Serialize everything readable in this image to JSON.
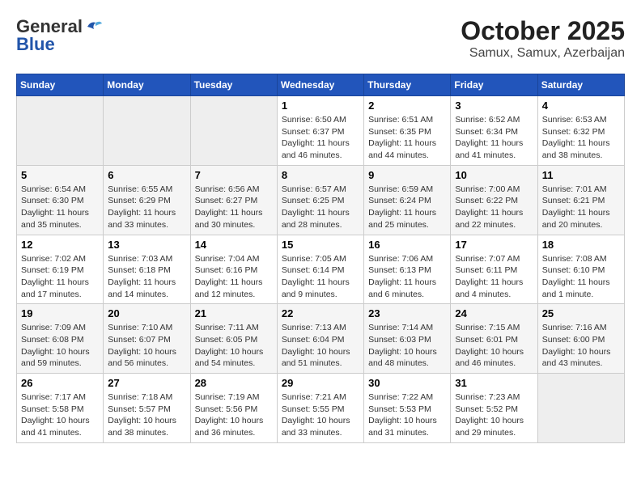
{
  "logo": {
    "line1": "General",
    "line2": "Blue"
  },
  "title": "October 2025",
  "subtitle": "Samux, Samux, Azerbaijan",
  "days_of_week": [
    "Sunday",
    "Monday",
    "Tuesday",
    "Wednesday",
    "Thursday",
    "Friday",
    "Saturday"
  ],
  "weeks": [
    [
      {
        "day": "",
        "info": ""
      },
      {
        "day": "",
        "info": ""
      },
      {
        "day": "",
        "info": ""
      },
      {
        "day": "1",
        "info": "Sunrise: 6:50 AM\nSunset: 6:37 PM\nDaylight: 11 hours and 46 minutes."
      },
      {
        "day": "2",
        "info": "Sunrise: 6:51 AM\nSunset: 6:35 PM\nDaylight: 11 hours and 44 minutes."
      },
      {
        "day": "3",
        "info": "Sunrise: 6:52 AM\nSunset: 6:34 PM\nDaylight: 11 hours and 41 minutes."
      },
      {
        "day": "4",
        "info": "Sunrise: 6:53 AM\nSunset: 6:32 PM\nDaylight: 11 hours and 38 minutes."
      }
    ],
    [
      {
        "day": "5",
        "info": "Sunrise: 6:54 AM\nSunset: 6:30 PM\nDaylight: 11 hours and 35 minutes."
      },
      {
        "day": "6",
        "info": "Sunrise: 6:55 AM\nSunset: 6:29 PM\nDaylight: 11 hours and 33 minutes."
      },
      {
        "day": "7",
        "info": "Sunrise: 6:56 AM\nSunset: 6:27 PM\nDaylight: 11 hours and 30 minutes."
      },
      {
        "day": "8",
        "info": "Sunrise: 6:57 AM\nSunset: 6:25 PM\nDaylight: 11 hours and 28 minutes."
      },
      {
        "day": "9",
        "info": "Sunrise: 6:59 AM\nSunset: 6:24 PM\nDaylight: 11 hours and 25 minutes."
      },
      {
        "day": "10",
        "info": "Sunrise: 7:00 AM\nSunset: 6:22 PM\nDaylight: 11 hours and 22 minutes."
      },
      {
        "day": "11",
        "info": "Sunrise: 7:01 AM\nSunset: 6:21 PM\nDaylight: 11 hours and 20 minutes."
      }
    ],
    [
      {
        "day": "12",
        "info": "Sunrise: 7:02 AM\nSunset: 6:19 PM\nDaylight: 11 hours and 17 minutes."
      },
      {
        "day": "13",
        "info": "Sunrise: 7:03 AM\nSunset: 6:18 PM\nDaylight: 11 hours and 14 minutes."
      },
      {
        "day": "14",
        "info": "Sunrise: 7:04 AM\nSunset: 6:16 PM\nDaylight: 11 hours and 12 minutes."
      },
      {
        "day": "15",
        "info": "Sunrise: 7:05 AM\nSunset: 6:14 PM\nDaylight: 11 hours and 9 minutes."
      },
      {
        "day": "16",
        "info": "Sunrise: 7:06 AM\nSunset: 6:13 PM\nDaylight: 11 hours and 6 minutes."
      },
      {
        "day": "17",
        "info": "Sunrise: 7:07 AM\nSunset: 6:11 PM\nDaylight: 11 hours and 4 minutes."
      },
      {
        "day": "18",
        "info": "Sunrise: 7:08 AM\nSunset: 6:10 PM\nDaylight: 11 hours and 1 minute."
      }
    ],
    [
      {
        "day": "19",
        "info": "Sunrise: 7:09 AM\nSunset: 6:08 PM\nDaylight: 10 hours and 59 minutes."
      },
      {
        "day": "20",
        "info": "Sunrise: 7:10 AM\nSunset: 6:07 PM\nDaylight: 10 hours and 56 minutes."
      },
      {
        "day": "21",
        "info": "Sunrise: 7:11 AM\nSunset: 6:05 PM\nDaylight: 10 hours and 54 minutes."
      },
      {
        "day": "22",
        "info": "Sunrise: 7:13 AM\nSunset: 6:04 PM\nDaylight: 10 hours and 51 minutes."
      },
      {
        "day": "23",
        "info": "Sunrise: 7:14 AM\nSunset: 6:03 PM\nDaylight: 10 hours and 48 minutes."
      },
      {
        "day": "24",
        "info": "Sunrise: 7:15 AM\nSunset: 6:01 PM\nDaylight: 10 hours and 46 minutes."
      },
      {
        "day": "25",
        "info": "Sunrise: 7:16 AM\nSunset: 6:00 PM\nDaylight: 10 hours and 43 minutes."
      }
    ],
    [
      {
        "day": "26",
        "info": "Sunrise: 7:17 AM\nSunset: 5:58 PM\nDaylight: 10 hours and 41 minutes."
      },
      {
        "day": "27",
        "info": "Sunrise: 7:18 AM\nSunset: 5:57 PM\nDaylight: 10 hours and 38 minutes."
      },
      {
        "day": "28",
        "info": "Sunrise: 7:19 AM\nSunset: 5:56 PM\nDaylight: 10 hours and 36 minutes."
      },
      {
        "day": "29",
        "info": "Sunrise: 7:21 AM\nSunset: 5:55 PM\nDaylight: 10 hours and 33 minutes."
      },
      {
        "day": "30",
        "info": "Sunrise: 7:22 AM\nSunset: 5:53 PM\nDaylight: 10 hours and 31 minutes."
      },
      {
        "day": "31",
        "info": "Sunrise: 7:23 AM\nSunset: 5:52 PM\nDaylight: 10 hours and 29 minutes."
      },
      {
        "day": "",
        "info": ""
      }
    ]
  ]
}
